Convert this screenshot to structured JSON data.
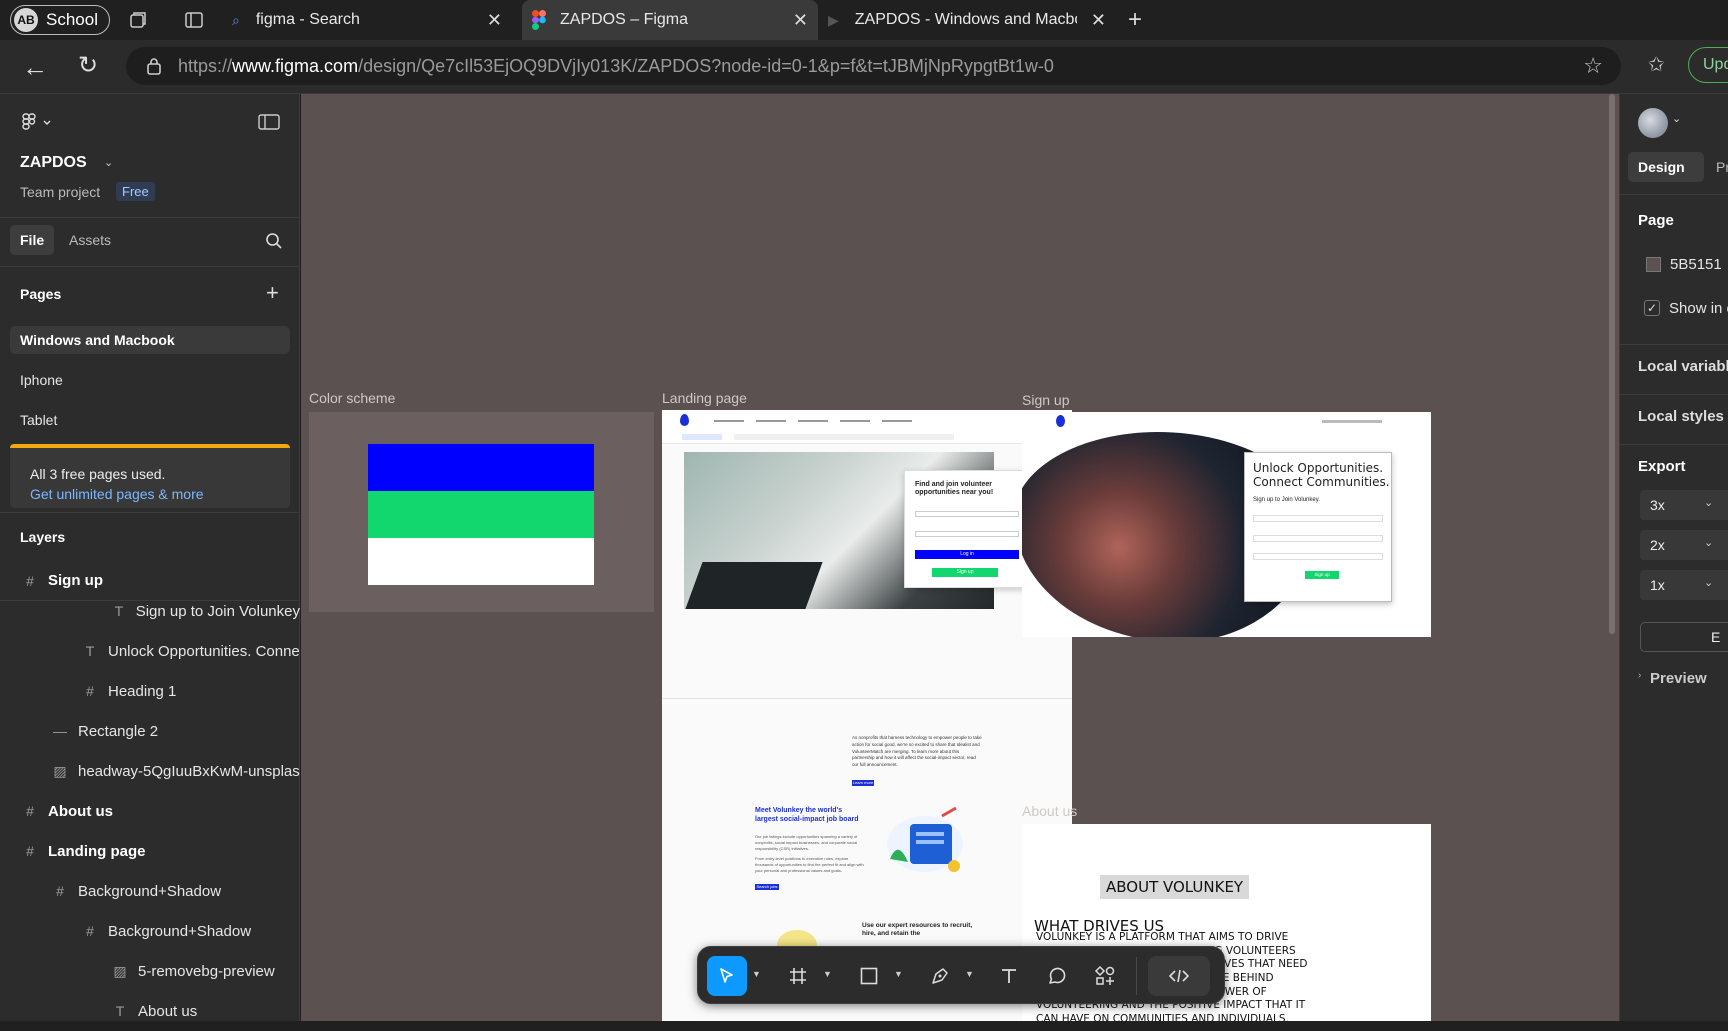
{
  "browser": {
    "profile_initials": "AB",
    "profile_name": "School",
    "tabs": [
      {
        "title": "figma - Search"
      },
      {
        "title": "ZAPDOS – Figma"
      },
      {
        "title": "ZAPDOS - Windows and Macbook"
      }
    ],
    "url_prefix": "https://",
    "url_host": "www.figma.com",
    "url_path": "/design/Qe7cIl53EjOQ9DVjIy013K/ZAPDOS?node-id=0-1&p=f&t=tJBMjNpRypgtBt1w-0",
    "update_label": "Upd"
  },
  "left_panel": {
    "file_name": "ZAPDOS",
    "team_label": "Team project",
    "plan_badge": "Free",
    "tabs": {
      "file": "File",
      "assets": "Assets"
    },
    "pages_heading": "Pages",
    "pages": [
      {
        "name": "Windows and Macbook",
        "selected": true
      },
      {
        "name": "Iphone",
        "selected": false
      },
      {
        "name": "Tablet",
        "selected": false
      }
    ],
    "upgrade": {
      "text": "All 3 free pages used.",
      "link": "Get unlimited pages & more"
    },
    "layers_heading": "Layers",
    "layers": [
      {
        "name": "Sign up",
        "type": "frame-icon",
        "bold": true
      },
      {
        "name": "Sign up to Join Volunkey",
        "type": "text-icon",
        "bold": false
      },
      {
        "name": "Unlock Opportunities. Conne",
        "type": "text-icon",
        "bold": false
      },
      {
        "name": "Heading 1",
        "type": "frame-icon",
        "bold": false
      },
      {
        "name": "Rectangle 2",
        "type": "line-icon",
        "bold": false
      },
      {
        "name": "headway-5QgIuuBxKwM-unsplas",
        "type": "image-icon",
        "bold": false
      },
      {
        "name": "About us",
        "type": "frame-icon",
        "bold": true
      },
      {
        "name": "Landing page",
        "type": "frame-icon",
        "bold": true
      },
      {
        "name": "Background+Shadow",
        "type": "frame-icon",
        "bold": false
      },
      {
        "name": "Background+Shadow",
        "type": "frame-icon",
        "bold": false
      },
      {
        "name": "5-removebg-preview",
        "type": "image-icon",
        "bold": false
      },
      {
        "name": "About us",
        "type": "text-icon",
        "bold": false
      }
    ]
  },
  "canvas": {
    "bg_color": "#5B5151",
    "frames": {
      "color_scheme": "Color scheme",
      "landing_page": "Landing page",
      "sign_up": "Sign up",
      "about_us": "About us"
    },
    "color_scheme_colors": [
      "#0000FF",
      "#12D66E",
      "#FFFFFF"
    ],
    "landing": {
      "hero_title": "Find and join volunteer opportunities near you!",
      "login_btn": "Log in",
      "signup_btn": "Sign up",
      "mission": "As nonprofits that harness technology to empower people to take action for social good, we're so excited to share that Idealist and VolunteerMatch are merging. To learn more about this partnership and how it will affect the social-impact sector, read our full announcement.",
      "learn_more": "Learn more",
      "meet_title": "Meet Volunkey the world's largest social-impact job board",
      "meet_body": "Our job listings include opportunities spanning a variety of nonprofits, social impact businesses, and corporate social responsibility (CSR) initiatives.",
      "meet_body2": "From entry-level positions to executive roles, explore thousands of opportunities to find the perfect fit and align with your personal and professional values and goals.",
      "search_jobs": "Search jobs",
      "expert_title": "Use our expert resources to recruit, hire, and retain the"
    },
    "signup": {
      "heading_line1": "Unlock Opportunities.",
      "heading_line2": "Connect Communities.",
      "subheading": "Sign up to Join Volunkey.",
      "button": "Sign up"
    },
    "about": {
      "title": "ABOUT VOLUNKEY",
      "subtitle": "WHAT DRIVES US",
      "body": "VOLUNKEY IS A PLATFORM THAT AIMS TO DRIVE POSITIVE CHANGE BY CONNECTING VOLUNTEERS WITH ORGANIZATIONS AND INITIATIVES THAT NEED THEM. THE PRIMARY DRIVING FORCE BEHIND VOLUNKEY IS THE BELIEF IN THE POWER OF VOLUNTEERING AND THE POSITIVE IMPACT THAT IT CAN HAVE ON COMMUNITIES AND INDIVIDUALS."
    }
  },
  "right_panel": {
    "tabs": {
      "design": "Design",
      "prototype": "Pr"
    },
    "page_heading": "Page",
    "page_color": "5B5151",
    "show_in_exports": "Show in e",
    "local_variables": "Local variable",
    "local_styles": "Local styles",
    "export_heading": "Export",
    "export_scales": [
      "3x",
      "2x",
      "1x"
    ],
    "export_button": "E",
    "preview": "Preview"
  }
}
